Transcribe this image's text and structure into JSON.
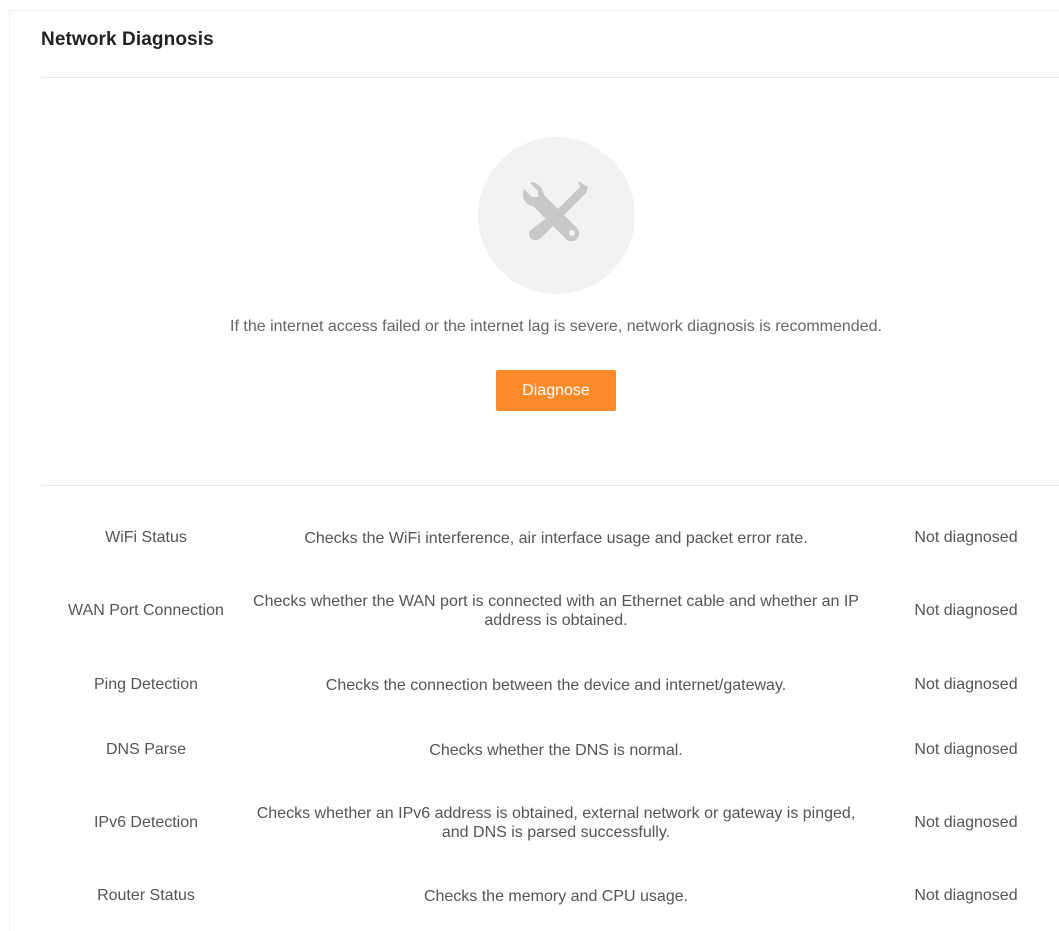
{
  "header": {
    "title": "Network Diagnosis"
  },
  "intro": {
    "icon": "tools-icon",
    "tip": "If the internet access failed or the internet lag is severe, network diagnosis is recommended.",
    "button_label": "Diagnose",
    "accent_color": "#ff8a2a"
  },
  "checks": [
    {
      "name": "WiFi Status",
      "description": "Checks the WiFi interference, air interface usage and packet error rate.",
      "status": "Not diagnosed"
    },
    {
      "name": "WAN Port Connection",
      "description": "Checks whether the WAN port is connected with an Ethernet cable and whether an IP address is obtained.",
      "status": "Not diagnosed"
    },
    {
      "name": "Ping Detection",
      "description": "Checks the connection between the device and internet/gateway.",
      "status": "Not diagnosed"
    },
    {
      "name": "DNS Parse",
      "description": "Checks whether the DNS is normal.",
      "status": "Not diagnosed"
    },
    {
      "name": "IPv6 Detection",
      "description": "Checks whether an IPv6 address is obtained, external network or gateway is pinged, and DNS is parsed successfully.",
      "status": "Not diagnosed"
    },
    {
      "name": "Router Status",
      "description": "Checks the memory and CPU usage.",
      "status": "Not diagnosed"
    }
  ]
}
